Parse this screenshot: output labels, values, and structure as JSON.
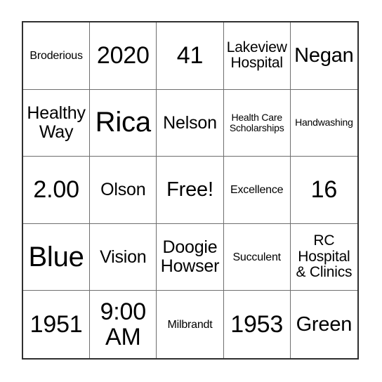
{
  "card": {
    "type": "bingo-card",
    "rows": 5,
    "columns": 5,
    "free_space_index": 12,
    "colors": {
      "background": "#ffffff",
      "text": "#000000",
      "outer_border": "#2f2f2f",
      "grid_line": "#6e6e6e"
    },
    "cells": [
      {
        "text": "Broderious",
        "size": "xs"
      },
      {
        "text": "2020",
        "size": "xl"
      },
      {
        "text": "41",
        "size": "xl"
      },
      {
        "text": "Lakeview\nHospital",
        "size": "sm"
      },
      {
        "text": "Negan",
        "size": "lg"
      },
      {
        "text": "Healthy\nWay",
        "size": "md"
      },
      {
        "text": "Rica",
        "size": "xxl"
      },
      {
        "text": "Nelson",
        "size": "md"
      },
      {
        "text": "Health Care\nScholarships",
        "size": "xxs"
      },
      {
        "text": "Handwashing",
        "size": "xxs"
      },
      {
        "text": "2.00",
        "size": "xl"
      },
      {
        "text": "Olson",
        "size": "md"
      },
      {
        "text": "Free!",
        "size": "lg"
      },
      {
        "text": "Excellence",
        "size": "xs"
      },
      {
        "text": "16",
        "size": "xl"
      },
      {
        "text": "Blue",
        "size": "xxl"
      },
      {
        "text": "Vision",
        "size": "md"
      },
      {
        "text": "Doogie\nHowser",
        "size": "md"
      },
      {
        "text": "Succulent",
        "size": "xs"
      },
      {
        "text": "RC\nHospital\n& Clinics",
        "size": "sm"
      },
      {
        "text": "1951",
        "size": "xl"
      },
      {
        "text": "9:00\nAM",
        "size": "xl"
      },
      {
        "text": "Milbrandt",
        "size": "xs"
      },
      {
        "text": "1953",
        "size": "xl"
      },
      {
        "text": "Green",
        "size": "lg"
      }
    ]
  }
}
